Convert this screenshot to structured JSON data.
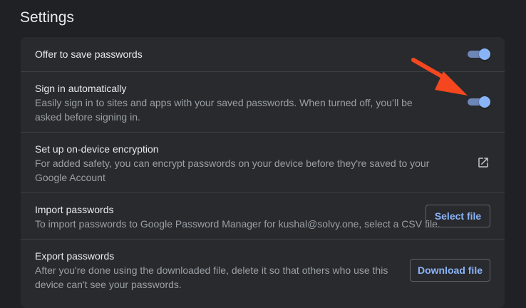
{
  "page": {
    "title": "Settings"
  },
  "settings": {
    "offer_to_save": {
      "title": "Offer to save passwords",
      "enabled": true
    },
    "sign_in_auto": {
      "title": "Sign in automatically",
      "description": "Easily sign in to sites and apps with your saved passwords. When turned off, you’ll be asked before signing in.",
      "enabled": true
    },
    "encryption": {
      "title": "Set up on-device encryption",
      "description": "For added safety, you can encrypt passwords on your device before they're saved to your Google Account",
      "icon": "open-in-new-icon"
    },
    "import": {
      "title": "Import passwords",
      "description": "To import passwords to Google Password Manager for kushal@solvy.one, select a CSV file.",
      "button_label": "Select file"
    },
    "export": {
      "title": "Export passwords",
      "description": "After you're done using the downloaded file, delete it so that others who use this device can't see your passwords.",
      "button_label": "Download file"
    }
  },
  "colors": {
    "background": "#202124",
    "card": "#292a2d",
    "divider": "#3c4043",
    "accent": "#8ab4f8",
    "annotation_arrow": "#f4471f"
  },
  "annotation": {
    "icon": "red-arrow-icon"
  }
}
